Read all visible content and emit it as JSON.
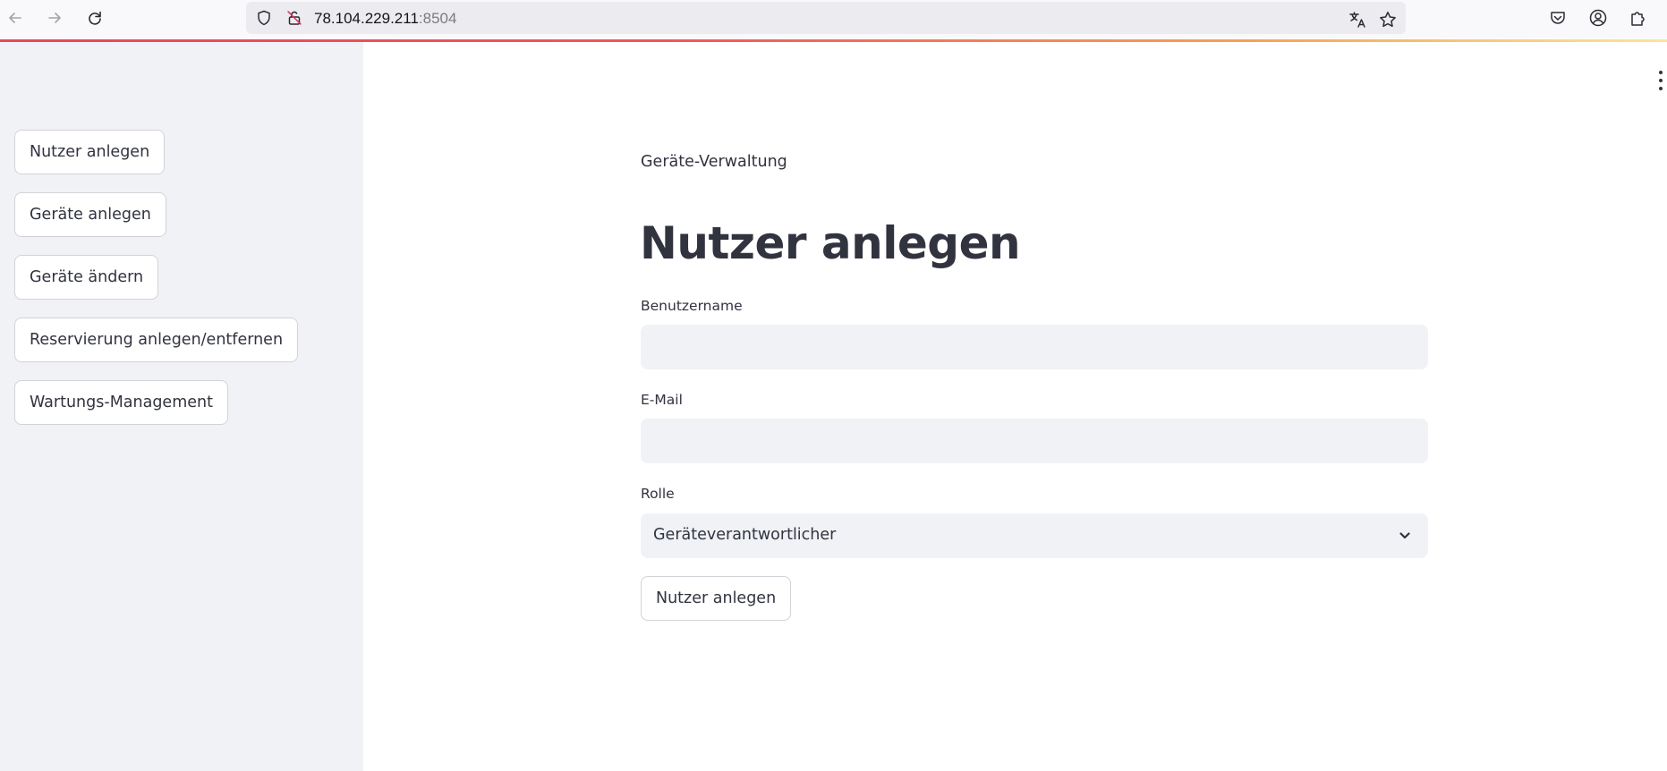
{
  "browser": {
    "url_host": "78.104.229.211",
    "url_port": ":8504",
    "icons": [
      "back-arrow-icon",
      "forward-arrow-icon",
      "reload-icon",
      "shield-icon",
      "insecure-lock-icon",
      "translate-icon",
      "star-icon",
      "pocket-icon",
      "account-icon",
      "extensions-icon"
    ],
    "loading_bar_colors": [
      "#e8475a",
      "#f7a154",
      "#fbe59a"
    ]
  },
  "sidebar": {
    "items": [
      {
        "label": "Nutzer anlegen"
      },
      {
        "label": "Geräte anlegen"
      },
      {
        "label": "Geräte ändern"
      },
      {
        "label": "Reservierung anlegen/entfernen"
      },
      {
        "label": "Wartungs-Management"
      }
    ]
  },
  "main": {
    "caption": "Geräte-Verwaltung",
    "title": "Nutzer anlegen",
    "username": {
      "label": "Benutzername",
      "value": ""
    },
    "email": {
      "label": "E-Mail",
      "value": ""
    },
    "role": {
      "label": "Rolle",
      "selected": "Geräteverantwortlicher"
    },
    "submit_label": "Nutzer anlegen"
  },
  "colors": {
    "sidebar_bg": "#f0f2f6",
    "input_bg": "#f0f2f6",
    "text": "#31333f",
    "button_border": "#d2d3d9"
  }
}
